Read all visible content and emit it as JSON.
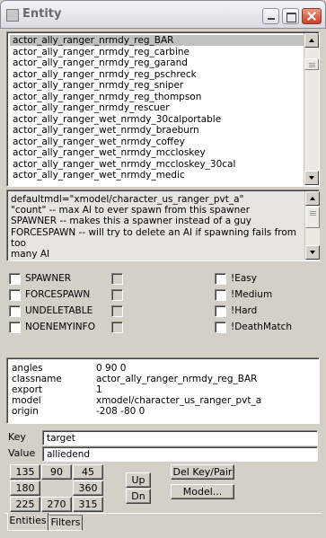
{
  "window": {
    "title": "Entity"
  },
  "entity_list": {
    "items": [
      "actor_ally_ranger_nrmdy_reg_BAR",
      "actor_ally_ranger_nrmdy_reg_carbine",
      "actor_ally_ranger_nrmdy_reg_garand",
      "actor_ally_ranger_nrmdy_reg_pschreck",
      "actor_ally_ranger_nrmdy_reg_sniper",
      "actor_ally_ranger_nrmdy_reg_thompson",
      "actor_ally_ranger_nrmdy_rescuer",
      "actor_ally_ranger_wet_nrmdy_30calportable",
      "actor_ally_ranger_wet_nrmdy_braeburn",
      "actor_ally_ranger_wet_nrmdy_coffey",
      "actor_ally_ranger_wet_nrmdy_mccloskey",
      "actor_ally_ranger_wet_nrmdy_mccloskey_30cal",
      "actor_ally_ranger_wet_nrmdy_medic"
    ],
    "selected_index": 0
  },
  "description": {
    "lines": [
      "defaultmdl=\"xmodel/character_us_ranger_pvt_a\"",
      "\"count\" -- max AI to ever spawn from this spawner",
      "SPAWNER -- makes this a spawner instead of a guy",
      "FORCESPAWN -- will try to delete an AI if spawning fails from too",
      "many AI"
    ]
  },
  "spawnflags": {
    "left": [
      "SPAWNER",
      "FORCESPAWN",
      "UNDELETABLE",
      "NOENEMYINFO"
    ],
    "right": [
      "!Easy",
      "!Medium",
      "!Hard",
      "!DeathMatch"
    ]
  },
  "properties": [
    {
      "key": "angles",
      "value": "0 90 0"
    },
    {
      "key": "classname",
      "value": "actor_ally_ranger_nrmdy_reg_BAR"
    },
    {
      "key": "export",
      "value": "1"
    },
    {
      "key": "model",
      "value": "xmodel/character_us_ranger_pvt_a"
    },
    {
      "key": "origin",
      "value": "-208 -80 0"
    },
    {
      "key": "target",
      "value": "alliedend"
    }
  ],
  "editor": {
    "key_label": "Key",
    "key_value": "target",
    "value_label": "Value",
    "value_value": "alliedend"
  },
  "angle_buttons": [
    "135",
    "90",
    "45",
    "180",
    "360",
    "225",
    "270",
    "315"
  ],
  "buttons": {
    "up": "Up",
    "dn": "Dn",
    "del_key_pair": "Del Key/Pair",
    "model": "Model..."
  },
  "tabs": [
    "Entities",
    "Filters"
  ]
}
